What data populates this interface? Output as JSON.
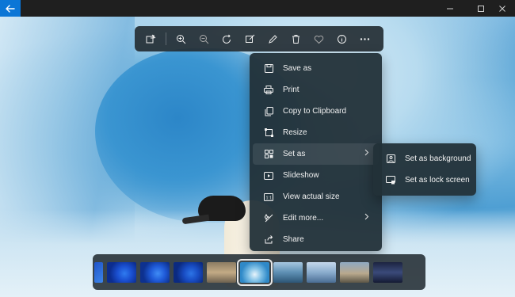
{
  "app": {
    "back_icon": "arrow-left-icon",
    "window_controls": [
      "minimize-icon",
      "maximize-icon",
      "close-icon"
    ]
  },
  "toolbar": {
    "buttons": [
      {
        "icon": "edit-image-icon"
      },
      {
        "icon": "zoom-in-icon"
      },
      {
        "icon": "zoom-out-icon"
      },
      {
        "icon": "rotate-icon"
      },
      {
        "icon": "enhance-icon"
      },
      {
        "icon": "draw-icon"
      },
      {
        "icon": "delete-icon"
      },
      {
        "icon": "favorite-icon"
      },
      {
        "icon": "info-icon"
      },
      {
        "icon": "more-icon"
      }
    ]
  },
  "menu": {
    "items": [
      {
        "label": "Save as",
        "icon": "save-icon"
      },
      {
        "label": "Print",
        "icon": "print-icon"
      },
      {
        "label": "Copy to Clipboard",
        "icon": "copy-icon"
      },
      {
        "label": "Resize",
        "icon": "resize-icon"
      },
      {
        "label": "Set as",
        "icon": "set-as-icon",
        "has_submenu": true,
        "active": true
      },
      {
        "label": "Slideshow",
        "icon": "slideshow-icon"
      },
      {
        "label": "View actual size",
        "icon": "actual-size-icon"
      },
      {
        "label": "Edit more...",
        "icon": "edit-more-icon",
        "has_submenu": true
      },
      {
        "label": "Share",
        "icon": "share-icon"
      }
    ]
  },
  "submenu": {
    "items": [
      {
        "label": "Set as background",
        "icon": "background-icon"
      },
      {
        "label": "Set as lock screen",
        "icon": "lock-screen-icon"
      }
    ]
  },
  "filmstrip": {
    "selected_index": 5,
    "thumb_count": 10
  },
  "colors": {
    "accent": "#0b76d6",
    "menu_bg": "#223038",
    "text": "#f2f2f2"
  }
}
